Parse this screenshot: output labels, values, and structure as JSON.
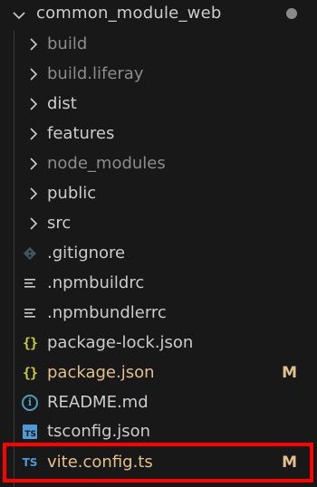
{
  "explorer": {
    "root": {
      "label": "common_module_web",
      "expanded": true,
      "has_changes_dot": true
    },
    "items": [
      {
        "label": "build",
        "type": "folder",
        "dimmed": true
      },
      {
        "label": "build.liferay",
        "type": "folder",
        "dimmed": true
      },
      {
        "label": "dist",
        "type": "folder",
        "dimmed": false
      },
      {
        "label": "features",
        "type": "folder",
        "dimmed": false
      },
      {
        "label": "node_modules",
        "type": "folder",
        "dimmed": true
      },
      {
        "label": "public",
        "type": "folder",
        "dimmed": false
      },
      {
        "label": "src",
        "type": "folder",
        "dimmed": false
      },
      {
        "label": ".gitignore",
        "type": "file",
        "icon": "git-diamond-icon"
      },
      {
        "label": ".npmbuildrc",
        "type": "file",
        "icon": "lines-icon"
      },
      {
        "label": ".npmbundlerrc",
        "type": "file",
        "icon": "lines-icon"
      },
      {
        "label": "package-lock.json",
        "type": "file",
        "icon": "json-braces-icon"
      },
      {
        "label": "package.json",
        "type": "file",
        "icon": "json-braces-icon",
        "status": "M"
      },
      {
        "label": "README.md",
        "type": "file",
        "icon": "info-icon"
      },
      {
        "label": "tsconfig.json",
        "type": "file",
        "icon": "tsconfig-icon"
      },
      {
        "label": "vite.config.ts",
        "type": "file",
        "icon": "typescript-icon",
        "status": "M",
        "highlighted": true
      }
    ],
    "icon_glyphs": {
      "json": "{}",
      "ts": "TS",
      "info": "i"
    }
  },
  "colors": {
    "background": "#181818",
    "text": "#cccccc",
    "dimmed_text": "#8c8c8c",
    "modified": "#e2c08d",
    "highlight_border": "#ff0000",
    "ts_blue": "#4f9ad6",
    "json_yellow": "#cbcb41"
  }
}
